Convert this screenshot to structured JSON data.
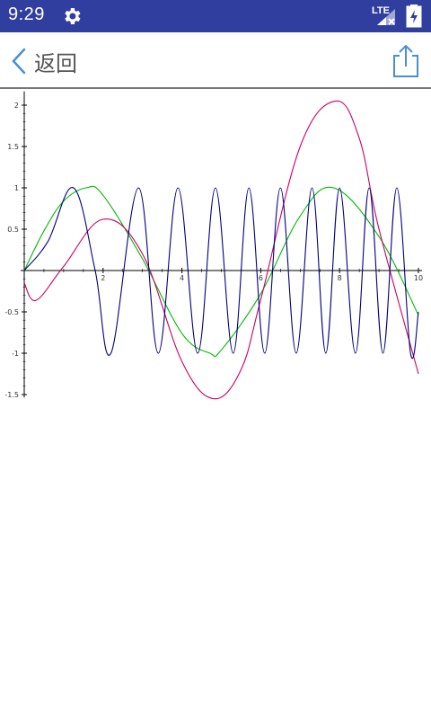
{
  "status_bar": {
    "time": "9:29",
    "network": "LTE",
    "settings_icon": "gear-icon",
    "signal_icon": "signal-icon",
    "battery_icon": "battery-charging-icon",
    "background": "#303f9f"
  },
  "app_bar": {
    "back_label": "返回",
    "back_icon": "chevron-left-icon",
    "share_icon": "share-icon",
    "accent": "#4a8fd0"
  },
  "chart_data": {
    "type": "line",
    "title": "",
    "xlabel": "",
    "ylabel": "",
    "xlim": [
      0,
      10
    ],
    "ylim": [
      -1.6,
      2.1
    ],
    "x_ticks": [
      {
        "label": "2",
        "value": 2
      },
      {
        "label": "4",
        "value": 4
      },
      {
        "label": "6",
        "value": 6
      },
      {
        "label": "8",
        "value": 8
      },
      {
        "label": "10",
        "value": 10
      }
    ],
    "y_ticks": [
      {
        "label": "2",
        "value": 2
      },
      {
        "label": "1.5",
        "value": 1.5
      },
      {
        "label": "1",
        "value": 1
      },
      {
        "label": "0.5",
        "value": 0.5
      },
      {
        "label": "-0.5",
        "value": -0.5
      },
      {
        "label": "-1",
        "value": -1
      },
      {
        "label": "-1.5",
        "value": -1.5
      }
    ],
    "grid": false,
    "legend": "none",
    "series": [
      {
        "color": "#00bb00",
        "x": [
          0,
          0.5,
          1.0,
          1.57,
          2.0,
          3.0,
          4.0,
          4.71,
          5.0,
          6.0,
          7.0,
          7.85,
          9.0,
          10.0
        ],
        "y": [
          0,
          0.48,
          0.84,
          1.0,
          0.91,
          0.14,
          -0.76,
          -1.0,
          -0.96,
          -0.28,
          0.66,
          1.0,
          0.41,
          -0.54
        ]
      },
      {
        "color": "#cc0066",
        "x": [
          0,
          0.3,
          1.0,
          2.0,
          3.0,
          4.0,
          4.8,
          5.5,
          6.0,
          7.0,
          7.9,
          8.5,
          9.0,
          10.0
        ],
        "y": [
          -0.15,
          -0.36,
          0.05,
          0.62,
          0.2,
          -1.1,
          -1.55,
          -1.2,
          -0.35,
          1.5,
          2.05,
          1.6,
          0.5,
          -1.25
        ],
        "x_at_peak": 7.9
      },
      {
        "color": "#000080",
        "x": [
          0,
          0.6,
          1.25,
          1.8,
          2.2,
          2.9,
          3.4,
          3.9,
          4.4,
          4.85,
          5.3,
          5.7,
          6.1,
          6.5,
          6.9,
          7.3,
          7.65,
          8.0,
          8.4,
          8.75,
          9.1,
          9.45,
          9.8,
          10.0
        ],
        "y": [
          0,
          0.35,
          1.0,
          0,
          -1.0,
          1.0,
          -1.0,
          1.0,
          -1.0,
          1.0,
          -1.0,
          1.0,
          -1.0,
          1.0,
          -1.0,
          1.0,
          -1.0,
          1.0,
          -1.0,
          1.0,
          -1.0,
          1.0,
          -1.0,
          -0.5
        ]
      }
    ]
  }
}
